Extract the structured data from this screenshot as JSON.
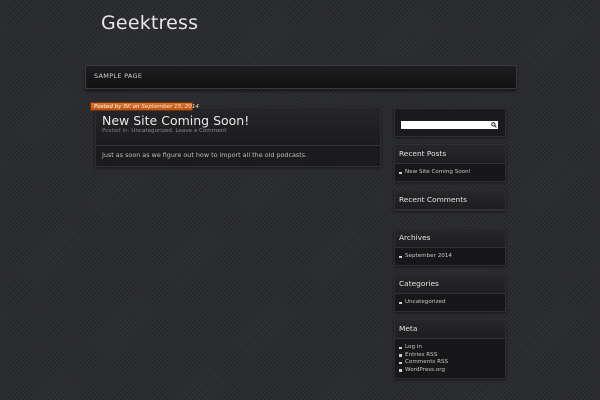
{
  "site": {
    "title": "Geektress"
  },
  "nav": {
    "items": [
      "SAMPLE PAGE"
    ]
  },
  "post": {
    "ribbon_prefix": "Posted by",
    "author": "BK",
    "ribbon_on": "on",
    "date": "September 15, 2014",
    "title": "New Site Coming Soon!",
    "meta_prefix": "Posted in:",
    "category": "Uncategorized",
    "comment_link": "Leave a Comment",
    "body": "Just as soon as we figure out how to import all the old podcasts."
  },
  "sidebar": {
    "search": {
      "placeholder": ""
    },
    "recent_posts": {
      "title": "Recent Posts",
      "items": [
        "New Site Coming Soon!"
      ]
    },
    "recent_comments": {
      "title": "Recent Comments"
    },
    "archives": {
      "title": "Archives",
      "items": [
        "September 2014"
      ]
    },
    "categories": {
      "title": "Categories",
      "items": [
        "Uncategorized"
      ]
    },
    "meta": {
      "title": "Meta",
      "items": [
        "Log in",
        "Entries RSS",
        "Comments RSS",
        "WordPress.org"
      ]
    }
  },
  "colors": {
    "ribbon": "#d9681f",
    "background": "#2c2d31"
  }
}
